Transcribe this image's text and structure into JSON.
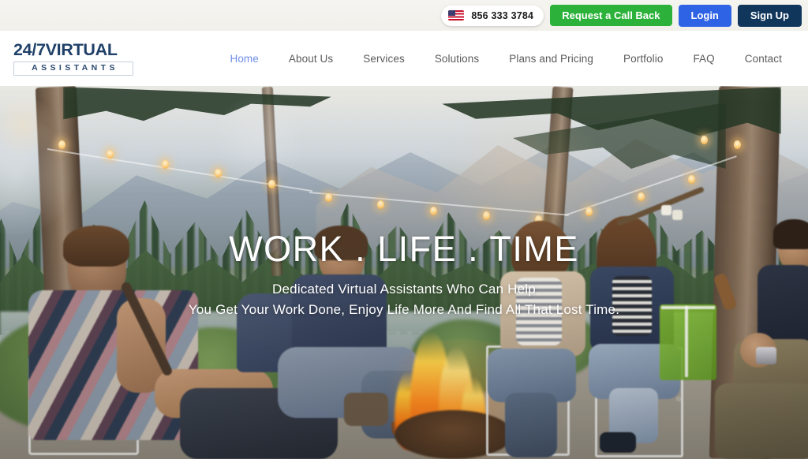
{
  "topbar": {
    "flag_icon": "us-flag-icon",
    "phone": "856 333 3784",
    "callback_label": "Request a Call Back",
    "login_label": "Login",
    "signup_label": "Sign Up",
    "callback_color": "#2cb23a",
    "login_color": "#2f63e6",
    "signup_color": "#11365c"
  },
  "header": {
    "logo": {
      "primary": "24/7VIRTUAL",
      "secondary": "ASSISTANTS",
      "color": "#1f4068"
    },
    "nav": [
      {
        "label": "Home",
        "active": true
      },
      {
        "label": "About Us",
        "active": false
      },
      {
        "label": "Services",
        "active": false
      },
      {
        "label": "Solutions",
        "active": false
      },
      {
        "label": "Plans and Pricing",
        "active": false
      },
      {
        "label": "Portfolio",
        "active": false
      },
      {
        "label": "FAQ",
        "active": false
      },
      {
        "label": "Contact",
        "active": false
      }
    ],
    "active_color": "#6f8fe8",
    "inactive_color": "#5b5b5b"
  },
  "hero": {
    "title": "WORK . LIFE . TIME",
    "subtitle_line1": "Dedicated Virtual Assistants Who Can Help",
    "subtitle_line2": "You Get Your Work Done, Enjoy Life More And Find All That Lost Time.",
    "background_description": "Group of friends sitting around a campfire by a river at dusk with string lights hung between pine trees and mountains behind"
  }
}
